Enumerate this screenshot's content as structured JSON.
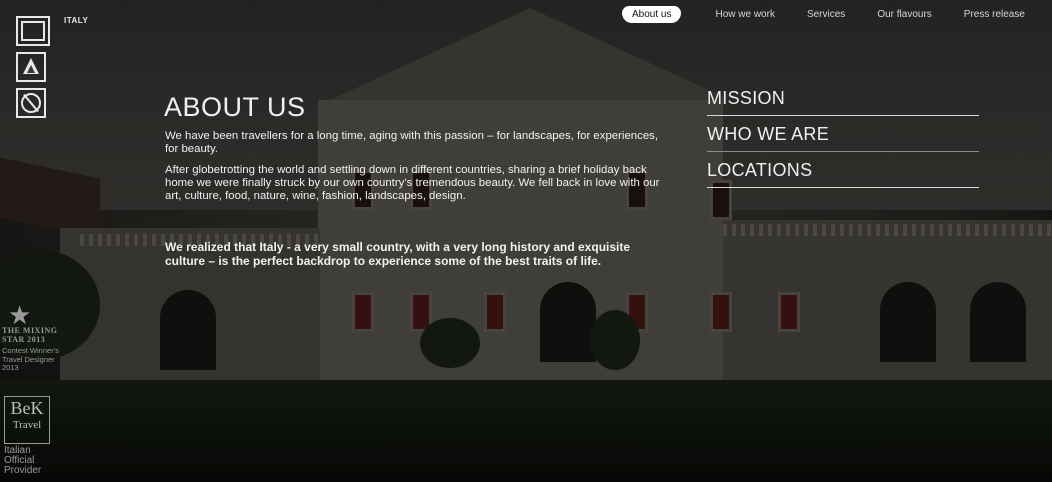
{
  "brand": {
    "wordmark": "ITALY"
  },
  "nav": {
    "items": [
      {
        "label": "About us",
        "active": true
      },
      {
        "label": "How we work",
        "active": false
      },
      {
        "label": "Services",
        "active": false
      },
      {
        "label": "Our flavours",
        "active": false
      },
      {
        "label": "Press release",
        "active": false
      }
    ]
  },
  "main": {
    "title": "ABOUT US",
    "paragraph1": "We have been travellers for a long time, aging with this passion – for landscapes, for experiences, for beauty.",
    "paragraph2": "After globetrotting the world and settling down in different countries, sharing a brief holiday back home we were finally struck by our own country’s tremendous beauty. We fell back in love with our art, culture, food, nature, wine, fashion, landscapes, design.",
    "paragraph3": "We realized that Italy - a very small country, with a very long history and exquisite culture – is the perfect backdrop to experience some of the best traits of life."
  },
  "side_menu": {
    "items": [
      {
        "label": "MISSION"
      },
      {
        "label": "WHO WE ARE"
      },
      {
        "label": "LOCATIONS"
      }
    ]
  },
  "badges": {
    "mixing_line1": "THE MIXING",
    "mixing_line2": "STAR 2013",
    "winner_line1": "Contest Winner's",
    "winner_line2": "Travel Designer",
    "winner_line3": "2013",
    "bk_line1": "BeK",
    "bk_line2": "Travel",
    "provider_line1": "Italian",
    "provider_line2": "Official",
    "provider_line3": "Provider"
  },
  "icons": {
    "logo_main": "framed-x-logo-icon",
    "logo_a": "triangle-a-logo-icon",
    "logo_circle": "circle-slash-logo-icon",
    "star": "star-icon"
  },
  "colors": {
    "text": "#f0f0f0",
    "nav_active_bg": "#ffffff",
    "muted": "#9a9a9a"
  }
}
